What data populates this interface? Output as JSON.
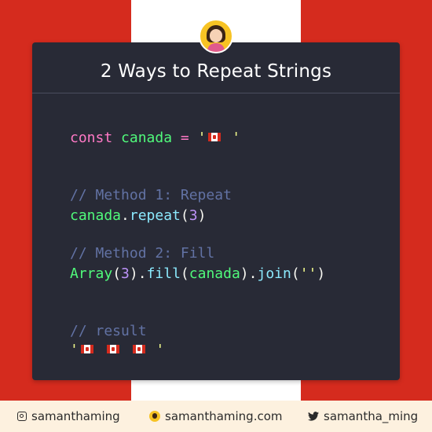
{
  "card": {
    "title": "2 Ways to Repeat Strings"
  },
  "code": {
    "line1": {
      "keyword": "const",
      "name": "canada",
      "equals": "=",
      "quote_open": "'",
      "quote_close": " '",
      "flag": "canadian-flag"
    },
    "comment1": "// Method 1: Repeat",
    "line2": {
      "obj": "canada",
      "dot": ".",
      "method": "repeat",
      "open": "(",
      "num": "3",
      "close": ")"
    },
    "comment2": "// Method 2: Fill",
    "line3": {
      "cls": "Array",
      "open1": "(",
      "num": "3",
      "close1": ")",
      "dot1": ".",
      "method1": "fill",
      "open2": "(",
      "arg": "canada",
      "close2": ")",
      "dot2": ".",
      "method2": "join",
      "open3": "(",
      "str": "''",
      "close3": ")"
    },
    "comment3": "// result",
    "result": {
      "quote_open": "'",
      "quote_close": " '",
      "flags": [
        "canadian-flag",
        "canadian-flag",
        "canadian-flag"
      ]
    }
  },
  "footer": {
    "instagram": "samanthaming",
    "website": "samanthaming.com",
    "twitter": "samantha_ming"
  },
  "colors": {
    "flag_red": "#d52b1e",
    "card_bg": "#282a36",
    "footer_bg": "#fdf1df"
  }
}
